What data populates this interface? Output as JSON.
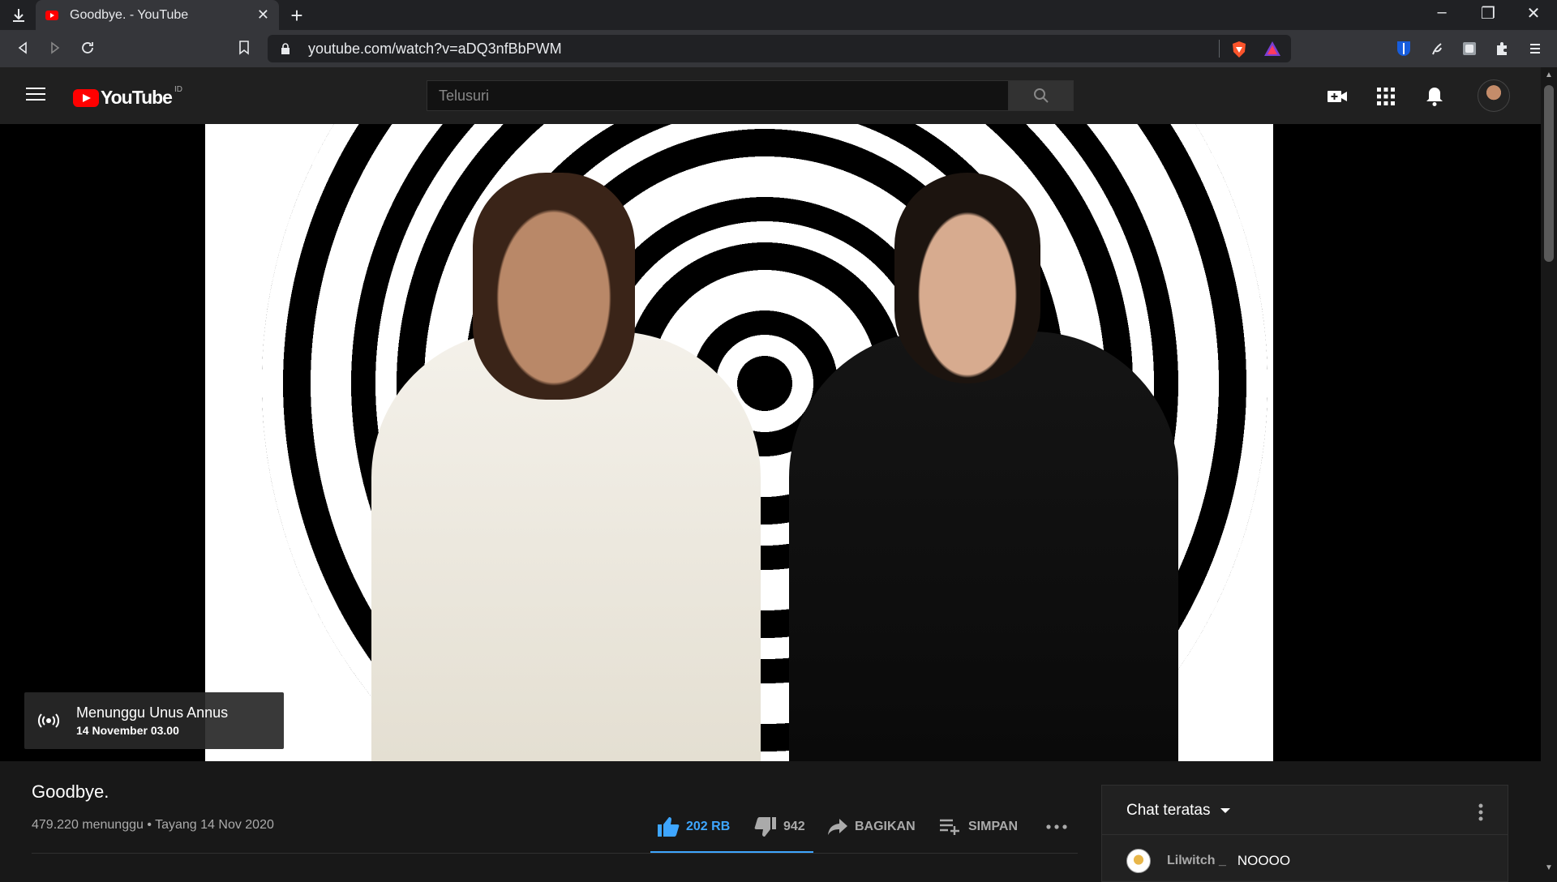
{
  "browser": {
    "tab_title": "Goodbye. - YouTube",
    "url": "youtube.com/watch?v=aDQ3nfBbPWM"
  },
  "header": {
    "logo_text": "YouTube",
    "country_code": "ID",
    "search_placeholder": "Telusuri"
  },
  "player": {
    "waiting_title": "Menunggu Unus Annus",
    "waiting_time": "14 November 03.00"
  },
  "video": {
    "title": "Goodbye.",
    "meta": "479.220 menunggu • Tayang 14 Nov 2020",
    "likes": "202 RB",
    "dislikes": "942",
    "share_label": "BAGIKAN",
    "save_label": "SIMPAN"
  },
  "chat": {
    "header": "Chat teratas",
    "messages": [
      {
        "author": "Lilwitch _",
        "text": "NOOOO"
      }
    ]
  },
  "colors": {
    "accent_blue": "#3ea6ff",
    "youtube_red": "#ff0000",
    "background": "#181818"
  },
  "icons": [
    "download-icon",
    "youtube-favicon",
    "back-icon",
    "forward-icon",
    "reload-icon",
    "bookmark-icon",
    "lock-icon",
    "brave-shield-icon",
    "brave-rewards-icon",
    "bitwarden-icon",
    "extension-icon",
    "puzzle-icon",
    "menu-icon",
    "hamburger-icon",
    "search-icon",
    "create-video-icon",
    "apps-icon",
    "bell-icon",
    "live-icon",
    "thumb-up-icon",
    "thumb-down-icon",
    "share-icon",
    "playlist-add-icon",
    "more-horiz-icon",
    "more-vert-icon"
  ]
}
